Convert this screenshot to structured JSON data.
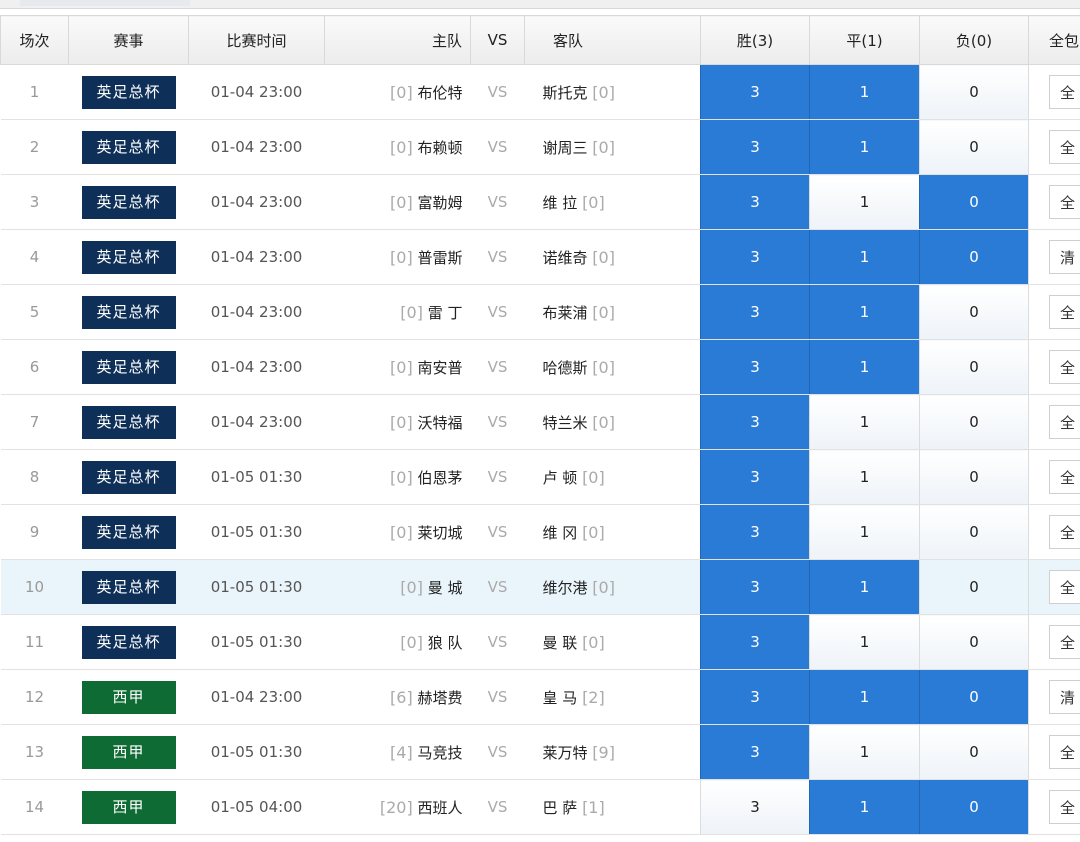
{
  "headers": {
    "no": "场次",
    "league": "赛事",
    "time": "比赛时间",
    "home": "主队",
    "vs": "VS",
    "away": "客队",
    "win": "胜(3)",
    "draw": "平(1)",
    "lose": "负(0)",
    "all": "全包"
  },
  "colors": {
    "selected_odd": "#2a7bd6",
    "league_epl_cup": "#0e2f57",
    "league_laliga": "#0d6b33",
    "highlight_row": "#eaf5fb"
  },
  "rows": [
    {
      "no": "1",
      "league": "英足总杯",
      "league_color": "blue",
      "time": "01-04 23:00",
      "home_rank": "[0]",
      "home": "布伦特",
      "vs": "VS",
      "away": "斯托克",
      "away_rank": "[0]",
      "win": "3",
      "draw": "1",
      "lose": "0",
      "sel": [
        true,
        true,
        false
      ],
      "all": "全"
    },
    {
      "no": "2",
      "league": "英足总杯",
      "league_color": "blue",
      "time": "01-04 23:00",
      "home_rank": "[0]",
      "home": "布赖顿",
      "vs": "VS",
      "away": "谢周三",
      "away_rank": "[0]",
      "win": "3",
      "draw": "1",
      "lose": "0",
      "sel": [
        true,
        true,
        false
      ],
      "all": "全"
    },
    {
      "no": "3",
      "league": "英足总杯",
      "league_color": "blue",
      "time": "01-04 23:00",
      "home_rank": "[0]",
      "home": "富勒姆",
      "vs": "VS",
      "away": "维 拉",
      "away_rank": "[0]",
      "win": "3",
      "draw": "1",
      "lose": "0",
      "sel": [
        true,
        false,
        true
      ],
      "all": "全"
    },
    {
      "no": "4",
      "league": "英足总杯",
      "league_color": "blue",
      "time": "01-04 23:00",
      "home_rank": "[0]",
      "home": "普雷斯",
      "vs": "VS",
      "away": "诺维奇",
      "away_rank": "[0]",
      "win": "3",
      "draw": "1",
      "lose": "0",
      "sel": [
        true,
        true,
        true
      ],
      "all": "清"
    },
    {
      "no": "5",
      "league": "英足总杯",
      "league_color": "blue",
      "time": "01-04 23:00",
      "home_rank": "[0]",
      "home": "雷 丁",
      "vs": "VS",
      "away": "布莱浦",
      "away_rank": "[0]",
      "win": "3",
      "draw": "1",
      "lose": "0",
      "sel": [
        true,
        true,
        false
      ],
      "all": "全"
    },
    {
      "no": "6",
      "league": "英足总杯",
      "league_color": "blue",
      "time": "01-04 23:00",
      "home_rank": "[0]",
      "home": "南安普",
      "vs": "VS",
      "away": "哈德斯",
      "away_rank": "[0]",
      "win": "3",
      "draw": "1",
      "lose": "0",
      "sel": [
        true,
        true,
        false
      ],
      "all": "全"
    },
    {
      "no": "7",
      "league": "英足总杯",
      "league_color": "blue",
      "time": "01-04 23:00",
      "home_rank": "[0]",
      "home": "沃特福",
      "vs": "VS",
      "away": "特兰米",
      "away_rank": "[0]",
      "win": "3",
      "draw": "1",
      "lose": "0",
      "sel": [
        true,
        false,
        false
      ],
      "all": "全"
    },
    {
      "no": "8",
      "league": "英足总杯",
      "league_color": "blue",
      "time": "01-05 01:30",
      "home_rank": "[0]",
      "home": "伯恩茅",
      "vs": "VS",
      "away": "卢 顿",
      "away_rank": "[0]",
      "win": "3",
      "draw": "1",
      "lose": "0",
      "sel": [
        true,
        false,
        false
      ],
      "all": "全"
    },
    {
      "no": "9",
      "league": "英足总杯",
      "league_color": "blue",
      "time": "01-05 01:30",
      "home_rank": "[0]",
      "home": "莱切城",
      "vs": "VS",
      "away": "维 冈",
      "away_rank": "[0]",
      "win": "3",
      "draw": "1",
      "lose": "0",
      "sel": [
        true,
        false,
        false
      ],
      "all": "全"
    },
    {
      "no": "10",
      "league": "英足总杯",
      "league_color": "blue",
      "time": "01-05 01:30",
      "home_rank": "[0]",
      "home": "曼 城",
      "vs": "VS",
      "away": "维尔港",
      "away_rank": "[0]",
      "win": "3",
      "draw": "1",
      "lose": "0",
      "sel": [
        true,
        true,
        false
      ],
      "all": "全",
      "highlight": true
    },
    {
      "no": "11",
      "league": "英足总杯",
      "league_color": "blue",
      "time": "01-05 01:30",
      "home_rank": "[0]",
      "home": "狼 队",
      "vs": "VS",
      "away": "曼 联",
      "away_rank": "[0]",
      "win": "3",
      "draw": "1",
      "lose": "0",
      "sel": [
        true,
        false,
        false
      ],
      "all": "全"
    },
    {
      "no": "12",
      "league": "西甲",
      "league_color": "green",
      "time": "01-04 23:00",
      "home_rank": "[6]",
      "home": "赫塔费",
      "vs": "VS",
      "away": "皇 马",
      "away_rank": "[2]",
      "win": "3",
      "draw": "1",
      "lose": "0",
      "sel": [
        true,
        true,
        true
      ],
      "all": "清"
    },
    {
      "no": "13",
      "league": "西甲",
      "league_color": "green",
      "time": "01-05 01:30",
      "home_rank": "[4]",
      "home": "马竞技",
      "vs": "VS",
      "away": "莱万特",
      "away_rank": "[9]",
      "win": "3",
      "draw": "1",
      "lose": "0",
      "sel": [
        true,
        false,
        false
      ],
      "all": "全"
    },
    {
      "no": "14",
      "league": "西甲",
      "league_color": "green",
      "time": "01-05 04:00",
      "home_rank": "[20]",
      "home": "西班人",
      "vs": "VS",
      "away": "巴 萨",
      "away_rank": "[1]",
      "win": "3",
      "draw": "1",
      "lose": "0",
      "sel": [
        false,
        true,
        true
      ],
      "all": "全"
    }
  ]
}
